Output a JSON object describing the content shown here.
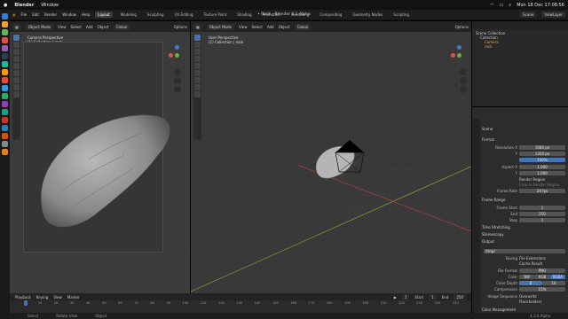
{
  "menubar": {
    "app": "Blender",
    "window": "Window",
    "datetime": "Mon 18 Dec 17:08:56"
  },
  "window_title": "• Rock - Blender 4.1 Alpha",
  "topbar": {
    "menus": [
      "File",
      "Edit",
      "Render",
      "Window",
      "Help"
    ],
    "workspaces": [
      "Layout",
      "Modeling",
      "Sculpting",
      "UV Editing",
      "Texture Paint",
      "Shading",
      "Animation",
      "Rendering",
      "Compositing",
      "Geometry Nodes",
      "Scripting"
    ],
    "active_workspace": "Layout",
    "scene_label": "Scene",
    "view_layer_label": "ViewLayer"
  },
  "viewport_left": {
    "mode": "Object Mode",
    "menus": [
      "View",
      "Select",
      "Add",
      "Object"
    ],
    "transform": "Global",
    "options": "Options",
    "view_name": "Camera Perspective",
    "collection": "(1) Collection | rock"
  },
  "viewport_main": {
    "mode": "Object Mode",
    "menus": [
      "View",
      "Select",
      "Add",
      "Object"
    ],
    "transform": "Global",
    "options": "Options",
    "view_name": "User Perspective",
    "collection": "(1) Collection | rock"
  },
  "outliner": {
    "items": [
      "Scene Collection",
      "Collection",
      "Camera",
      "rock"
    ]
  },
  "properties": {
    "scene": "Scene",
    "format_header": "Format",
    "resolution_x_label": "Resolution X",
    "resolution_x": "1080 px",
    "resolution_y_label": "Y",
    "resolution_y": "1350 px",
    "percent": "100%",
    "aspect_x_label": "Aspect X",
    "aspect_x": "1.000",
    "aspect_y_label": "Y",
    "aspect_y": "1.000",
    "render_region": "Render Region",
    "crop_label": "Crop to Render Region",
    "frame_rate_label": "Frame Rate",
    "frame_rate": "24 fps",
    "frame_range_header": "Frame Range",
    "frame_start_label": "Frame Start",
    "frame_start": "1",
    "end_label": "End",
    "frame_end": "250",
    "step_label": "Step",
    "frame_step": "1",
    "time_stretching": "Time Stretching",
    "stereoscopy": "Stereoscopy",
    "output_header": "Output",
    "output_path": "/tmp/",
    "saving_label": "Saving",
    "file_extensions": "File Extensions",
    "cache_result": "Cache Result",
    "file_format_label": "File Format",
    "file_format": "PNG",
    "color_label": "Color",
    "color_options": [
      "BW",
      "RGB",
      "RGBA"
    ],
    "color_depth_label": "Color Depth",
    "color_depth_options": [
      "8",
      "16"
    ],
    "compression_label": "Compression",
    "compression": "15%",
    "image_sequence_label": "Image Sequence",
    "overwrite": "Overwrite",
    "placeholders": "Placeholders",
    "color_management": "Color Management"
  },
  "timeline": {
    "menus": [
      "Playback",
      "Keying",
      "View",
      "Marker"
    ],
    "current_frame": "1",
    "start_label": "Start",
    "start": "1",
    "end_label": "End",
    "end": "250",
    "ticks": [
      "1",
      "10",
      "20",
      "30",
      "40",
      "50",
      "60",
      "70",
      "80",
      "90",
      "100",
      "110",
      "120",
      "130",
      "140",
      "150",
      "160",
      "170",
      "180",
      "190",
      "200",
      "210",
      "220",
      "230",
      "240",
      "250"
    ]
  },
  "statusbar": {
    "items": [
      "Select",
      "Rotate View",
      "Object"
    ],
    "version": "4.1.0 Alpha"
  }
}
